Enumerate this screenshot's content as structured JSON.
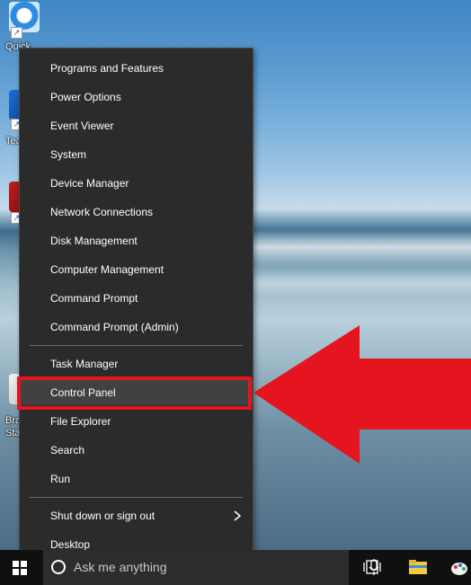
{
  "desktop_icons": [
    {
      "label": "Quick",
      "icon": "quicktime-icon"
    },
    {
      "label": "Tea",
      "icon": "teamviewer-icon"
    },
    {
      "label": "",
      "icon": "red-app-icon"
    },
    {
      "label": "Bra",
      "label2": "Star",
      "icon": "app-icon"
    }
  ],
  "menu": {
    "group1": [
      "Programs and Features",
      "Power Options",
      "Event Viewer",
      "System",
      "Device Manager",
      "Network Connections",
      "Disk Management",
      "Computer Management",
      "Command Prompt",
      "Command Prompt (Admin)"
    ],
    "group2": [
      "Task Manager",
      "Control Panel",
      "File Explorer",
      "Search",
      "Run"
    ],
    "group3": [
      "Shut down or sign out",
      "Desktop"
    ],
    "highlighted_item": "Control Panel"
  },
  "annotation": {
    "arrow_color": "#e4151f",
    "box_color": "#e4151f"
  },
  "taskbar": {
    "search_placeholder": "Ask me anything",
    "icons": [
      "windows-start-icon",
      "cortana-icon",
      "microphone-icon",
      "task-view-icon",
      "file-explorer-icon",
      "paint-icon"
    ]
  }
}
